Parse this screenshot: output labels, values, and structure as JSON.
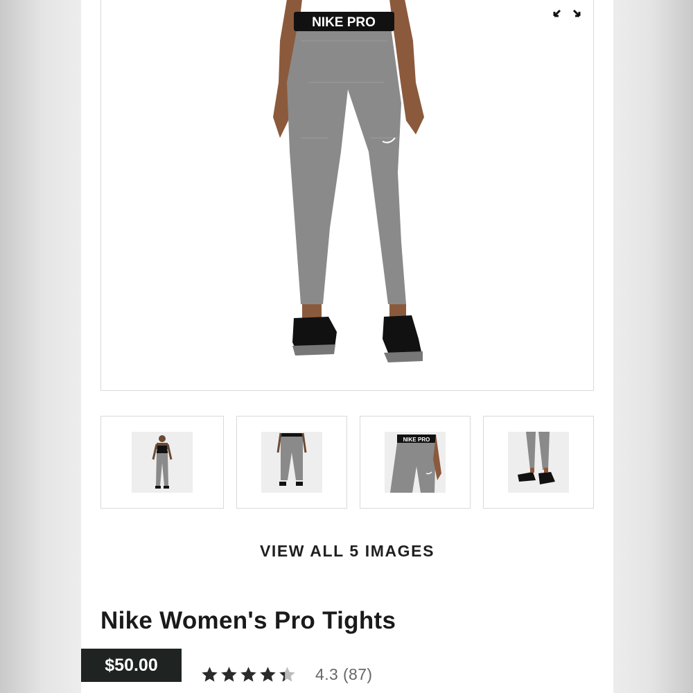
{
  "product": {
    "title": "Nike Women's Pro Tights",
    "price": "$50.00",
    "rating_value": 4.3,
    "rating_text": "4.3",
    "review_count": "(87)",
    "waistband_text": "NIKE PRO"
  },
  "gallery": {
    "view_all_label": "VIEW ALL 5 IMAGES",
    "thumbnails": [
      {
        "name": "full-body-front"
      },
      {
        "name": "full-body-back"
      },
      {
        "name": "waistband-closeup"
      },
      {
        "name": "lower-leg-shoes"
      }
    ]
  },
  "icons": {
    "expand": "expand-icon",
    "star": "star-icon"
  },
  "colors": {
    "tights": "#8a8a8a",
    "price_badge": "#1f2423",
    "star": "#2b2b2b",
    "star_empty": "#bdbdbd"
  }
}
